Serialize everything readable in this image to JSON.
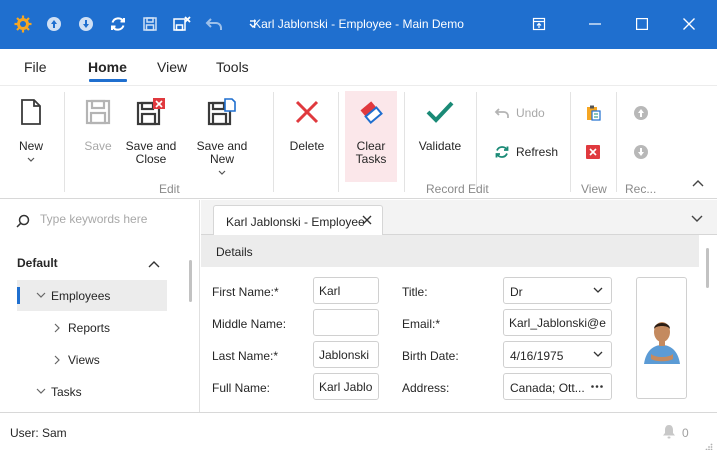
{
  "window": {
    "title": "Karl Jablonski - Employee - Main Demo",
    "accent": "#1f6fcf"
  },
  "quick_access": {
    "icons": [
      "app-gear-icon",
      "arrow-up-circle-icon",
      "arrow-down-circle-icon",
      "refresh-icon",
      "save-icon",
      "save-and-close-icon",
      "undo-icon",
      "customize-dropdown-icon"
    ]
  },
  "menu": {
    "tabs": [
      {
        "label": "File",
        "active": false
      },
      {
        "label": "Home",
        "active": true
      },
      {
        "label": "View",
        "active": false
      },
      {
        "label": "Tools",
        "active": false
      }
    ]
  },
  "ribbon": {
    "new_label": "New",
    "save_label": "Save",
    "save_and_close_label": "Save and Close",
    "save_and_new_label": "Save and New",
    "group_edit": "Edit",
    "delete_label": "Delete",
    "clear_tasks_label": "Clear Tasks",
    "validate_label": "Validate",
    "undo_label": "Undo",
    "refresh_label": "Refresh",
    "group_record_edit": "Record Edit",
    "group_view": "View",
    "group_rec": "Rec..."
  },
  "nav": {
    "search_placeholder": "Type keywords here",
    "group_label": "Default",
    "items": [
      {
        "label": "Employees",
        "selected": true,
        "expanded": true
      },
      {
        "label": "Reports",
        "selected": false,
        "expanded": false
      },
      {
        "label": "Views",
        "selected": false,
        "expanded": false
      },
      {
        "label": "Tasks",
        "selected": false,
        "expanded": true
      }
    ]
  },
  "doc": {
    "tab_label": "Karl Jablonski - Employee",
    "section_label": "Details",
    "fields": {
      "first_name_label": "First Name:*",
      "first_name_value": "Karl",
      "middle_name_label": "Middle Name:",
      "middle_name_value": "",
      "last_name_label": "Last Name:*",
      "last_name_value": "Jablonski",
      "full_name_label": "Full Name:",
      "full_name_value": "Karl Jablon",
      "title_label": "Title:",
      "title_value": "Dr",
      "email_label": "Email:*",
      "email_value": "Karl_Jablonski@exa",
      "birth_date_label": "Birth Date:",
      "birth_date_value": "4/16/1975",
      "address_label": "Address:",
      "address_value": "Canada; Ott..."
    }
  },
  "status": {
    "user": "User: Sam",
    "notification_count": "0"
  }
}
